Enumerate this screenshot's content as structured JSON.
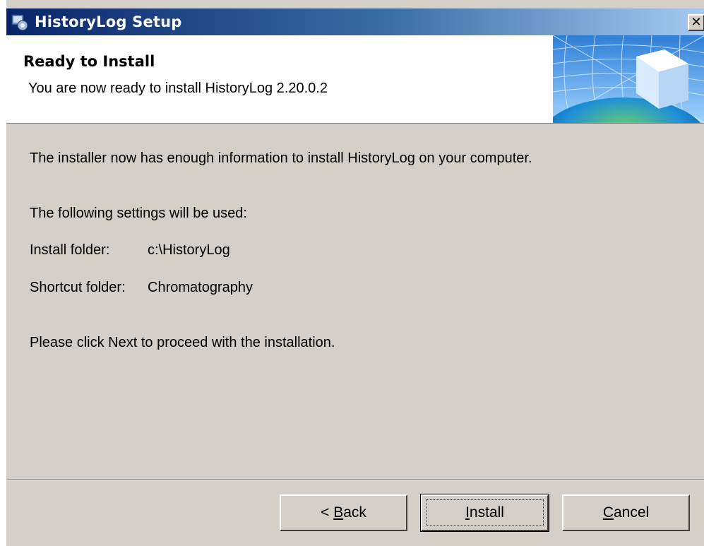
{
  "window": {
    "title": "HistoryLog Setup",
    "close_label": "✕"
  },
  "banner": {
    "title": "Ready to Install",
    "subtitle": "You are now ready to install HistoryLog 2.20.0.2"
  },
  "body": {
    "intro": "The installer now has enough information to install HistoryLog on your computer.",
    "settings_heading": "The following settings will be used:",
    "install_folder_label": "Install folder:",
    "install_folder_value": "c:\\HistoryLog",
    "shortcut_folder_label": "Shortcut folder:",
    "shortcut_folder_value": "Chromatography",
    "instruction": "Please click Next to proceed with the installation."
  },
  "buttons": {
    "back_prefix": "< ",
    "back_mnemonic": "B",
    "back_rest": "ack",
    "install_mnemonic": "I",
    "install_rest": "nstall",
    "cancel_mnemonic": "C",
    "cancel_rest": "ancel"
  },
  "colors": {
    "titlebar_start": "#0a246a",
    "titlebar_end": "#a6caf0",
    "dialog_face": "#d4d0c8"
  },
  "icons": [
    "setup-app-icon",
    "close-icon",
    "globe-cube-banner-art"
  ]
}
